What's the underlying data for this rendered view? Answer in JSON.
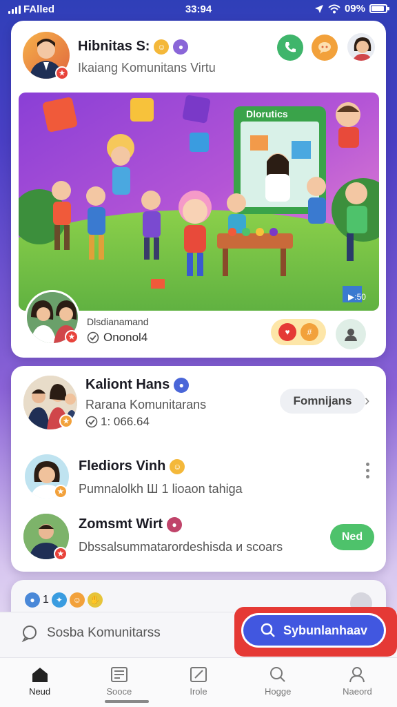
{
  "status_bar": {
    "carrier": "FAlled",
    "time": "33:94",
    "battery": "09%"
  },
  "post_card": {
    "title": "Hibnitas S:",
    "subtitle": "Ikaiang Komunitans Virtu",
    "hero_label": "Dlorutics",
    "hero_timestamp": "▶:50",
    "author_label": "Dlsdianamand",
    "author_stat": "Ononol4",
    "colors": {
      "call": "#3fb56b",
      "chat": "#f2a13b"
    }
  },
  "feed_card": {
    "rows": [
      {
        "title": "Kaliont Hans",
        "subtitle": "Rarana Komunitarans",
        "stat": "1: 066.64",
        "action_label": "Fomnijans"
      },
      {
        "title": "Flediors Vinh",
        "subtitle": "Pumnalolkh Ш 1 lioaon tahiga"
      },
      {
        "title": "Zomsmt Wirt",
        "subtitle": "Dbssalsummatarordeshisda и scoars",
        "action_label": "Ned"
      }
    ]
  },
  "partial_card": {
    "count": "1"
  },
  "search": {
    "placeholder": "Sosba Komunitarss",
    "cta_label": "Sybunlanhaav"
  },
  "tabs": [
    {
      "label": "Neud",
      "icon": "home-icon",
      "active": true
    },
    {
      "label": "Sooce",
      "icon": "news-icon",
      "active": false
    },
    {
      "label": "Irole",
      "icon": "edit-icon",
      "active": false
    },
    {
      "label": "Hogge",
      "icon": "search-icon",
      "active": false
    },
    {
      "label": "Naeord",
      "icon": "profile-icon",
      "active": false
    }
  ]
}
